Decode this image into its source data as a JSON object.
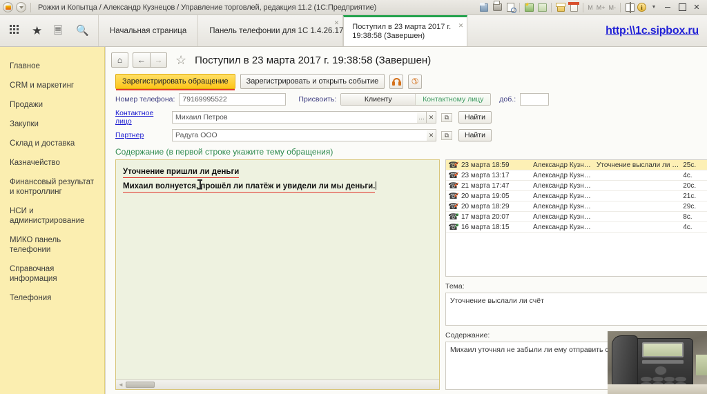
{
  "titlebar": {
    "title": "Рожки и Копытца / Александр Кузнецов / Управление торговлей, редакция 11.2  (1С:Предприятие)",
    "icons": [
      "save-icon",
      "print-icon",
      "print-preview-icon",
      "add-favorite-icon",
      "favorites-icon",
      "calculator-icon",
      "calendar-icon",
      "memory-m",
      "memory-m-plus",
      "memory-m-minus",
      "panel-icon",
      "info-icon",
      "dropdown-caret"
    ],
    "memory": {
      "m": "M",
      "m_plus": "M+",
      "m_minus": "M-"
    },
    "window": {
      "minimize": "–",
      "maximize": "□",
      "close": "✕"
    }
  },
  "tabstrip": {
    "tools": [
      "menu-grid-icon",
      "favorites-star-icon",
      "history-icon",
      "search-icon"
    ],
    "tabs": [
      {
        "label": "Начальная страница",
        "active": false,
        "closable": false
      },
      {
        "label": "Панель телефонии для 1С 1.4.26.17",
        "active": false,
        "closable": true
      },
      {
        "label": "Поступил в 23 марта 2017 г. 19:38:58 (Завершен)",
        "active": true,
        "closable": true
      }
    ],
    "site_link": "http:\\\\1c.sipbox.ru",
    "accent_green": "#23a24d"
  },
  "sidebar": {
    "items": [
      {
        "label": "Главное"
      },
      {
        "label": "CRM и маркетинг"
      },
      {
        "label": "Продажи"
      },
      {
        "label": "Закупки"
      },
      {
        "label": "Склад и доставка"
      },
      {
        "label": "Казначейство"
      },
      {
        "label": "Финансовый результат и контроллинг"
      },
      {
        "label": "НСИ и администрирование"
      },
      {
        "label": "МИКО панель телефонии"
      },
      {
        "label": "Справочная информация"
      },
      {
        "label": "Телефония"
      }
    ],
    "bg_color": "#fbeeb0"
  },
  "form": {
    "title": "Поступил в 23 марта 2017 г. 19:38:58 (Завершен)",
    "home_icon": "home-icon",
    "back_icon": "back-arrow-icon",
    "forward_icon": "forward-arrow-icon",
    "favorite_icon": "star-icon",
    "close_icon": "close-icon",
    "actions": {
      "register_request": "Зарегистрировать обращение",
      "register_and_open": "Зарегистрировать и открыть событие",
      "headset_icon": "headset-icon",
      "call_icon": "phone-handset-icon"
    },
    "phone": {
      "label": "Номер телефона:",
      "value": "79169995522",
      "assign_label": "Присвоить:",
      "assign_client": "Клиенту",
      "assign_contact": "Контактному лицу",
      "ext_label": "доб.:",
      "ext_value": ""
    },
    "contact": {
      "label": "Контактное лицо",
      "value": "Михаил Петров",
      "select_icon": "ellipsis-icon",
      "clear_icon": "clear-x-icon",
      "open_icon": "open-card-icon",
      "find_button": "Найти"
    },
    "partner": {
      "label": "Партнер",
      "value": "Радуга ООО",
      "clear_icon": "clear-x-icon",
      "open_icon": "open-card-icon",
      "find_button": "Найти"
    },
    "content_section_label": "Содержание (в первой строке укажите тему обращения)",
    "editor": {
      "line1": "Уточнение пришли ли деньги",
      "line2": "Михаил волнуется, прошёл ли платёж и увидели ли мы деньги.",
      "underline_color": "#e0332a",
      "bg_color": "#eef2e0"
    }
  },
  "calls": {
    "rows": [
      {
        "direction": "incoming",
        "date": "23 марта 18:59",
        "user": "Александр Кузн…",
        "topic": "Уточнение выслали ли …",
        "duration": "25с.",
        "flag": true,
        "selected": true
      },
      {
        "direction": "incoming",
        "date": "23 марта 13:17",
        "user": "Александр Кузн…",
        "topic": "",
        "duration": "4с.",
        "flag": false,
        "selected": false
      },
      {
        "direction": "incoming",
        "date": "21 марта 17:47",
        "user": "Александр Кузн…",
        "topic": "",
        "duration": "20с.",
        "flag": false,
        "selected": false
      },
      {
        "direction": "incoming",
        "date": "20 марта 19:05",
        "user": "Александр Кузн…",
        "topic": "",
        "duration": "21с.",
        "flag": false,
        "selected": false
      },
      {
        "direction": "incoming",
        "date": "20 марта 18:29",
        "user": "Александр Кузн…",
        "topic": "",
        "duration": "29с.",
        "flag": false,
        "selected": false
      },
      {
        "direction": "outgoing",
        "date": "17 марта 20:07",
        "user": "Александр Кузн…",
        "topic": "",
        "duration": "8с.",
        "flag": false,
        "selected": false
      },
      {
        "direction": "outgoing",
        "date": "16 марта 18:15",
        "user": "Александр Кузн…",
        "topic": "",
        "duration": "4с.",
        "flag": false,
        "selected": false
      }
    ],
    "selected_color": "#fdf0b5",
    "incoming_arrow_color": "#e0521a",
    "outgoing_arrow_color": "#3a9a44"
  },
  "details": {
    "theme_label": "Тема:",
    "theme_value": "Уточнение выслали ли счёт",
    "content_label": "Содержание:",
    "content_value": "Михаил уточнял не забыли ли ему отправить счёт"
  },
  "watermark": {
    "name": "ip-phone-photo"
  }
}
